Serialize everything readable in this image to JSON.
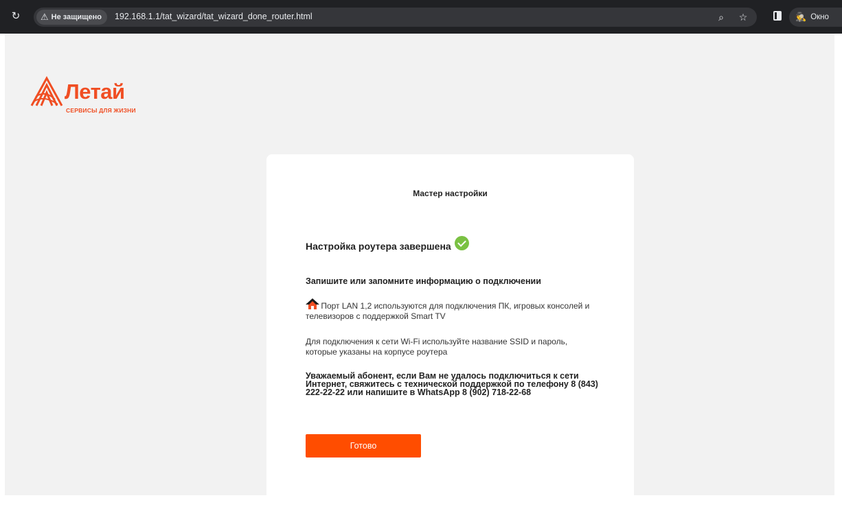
{
  "browser": {
    "security_label": "Не защищено",
    "url": "192.168.1.1/tat_wizard/tat_wizard_done_router.html",
    "incognito_label": "Окно"
  },
  "logo": {
    "name": "Летай",
    "tagline": "СЕРВИСЫ ДЛЯ ЖИЗНИ"
  },
  "wizard": {
    "title": "Мастер настройки",
    "done_title": "Настройка роутера завершена",
    "remember_heading": "Запишите или запомните информацию о подключении",
    "lan_info": "Порт LAN 1,2 используются для подключения ПК, игровых консолей и телевизоров с поддержкой Smart TV",
    "wifi_info": "Для подключения к сети Wi-Fi используйте название SSID и пароль, которые указаны на корпусе роутера",
    "support_info": "Уважаемый абонент, если Вам не удалось подключиться к сети Интернет, свяжитесь с технической поддержкой по телефону 8 (843) 222-22-22 или напишите в WhatsApp 8 (902) 718-22-68",
    "done_button": "Готово"
  },
  "colors": {
    "brand": "#f04e23",
    "button": "#ff4d00",
    "success": "#7ac143"
  }
}
